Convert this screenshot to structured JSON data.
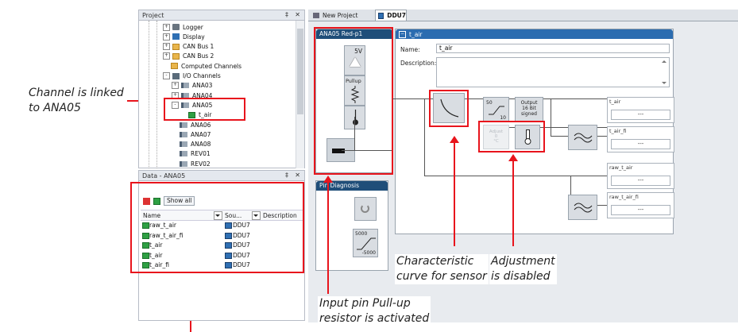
{
  "annotations": {
    "channel_linked": [
      "Channel is linked",
      "to ANA05"
    ],
    "characteristic": [
      "Characteristic",
      "curve for sensor"
    ],
    "adjustment": [
      "Adjustment",
      "is disabled"
    ],
    "pullup": [
      "Input pin Pull-up",
      "resistor is activated"
    ]
  },
  "project_panel": {
    "title": "Project",
    "pin_glyph": "‡",
    "close_glyph": "✕",
    "tree": [
      {
        "label": "Logger",
        "icon": "logger-icon",
        "indent": 0,
        "expander": "+"
      },
      {
        "label": "Display",
        "icon": "display-icon",
        "indent": 0,
        "expander": "+"
      },
      {
        "label": "CAN Bus 1",
        "icon": "folder-icon",
        "indent": 0,
        "expander": "+"
      },
      {
        "label": "CAN Bus 2",
        "icon": "folder-icon",
        "indent": 0,
        "expander": "+"
      },
      {
        "label": "Computed Channels",
        "icon": "folder-icon",
        "indent": 0,
        "expander": ""
      },
      {
        "label": "I/O Channels",
        "icon": "io-icon",
        "indent": 0,
        "expander": "-"
      },
      {
        "label": "ANA03",
        "icon": "pin-icon",
        "indent": 1,
        "expander": "+"
      },
      {
        "label": "ANA04",
        "icon": "pin-icon",
        "indent": 1,
        "expander": "+"
      },
      {
        "label": "ANA05",
        "icon": "pin-icon",
        "indent": 1,
        "expander": "-"
      },
      {
        "label": "t_air",
        "icon": "channel-icon",
        "indent": 2,
        "expander": ""
      },
      {
        "label": "ANA06",
        "icon": "pin-icon",
        "indent": 1,
        "expander": ""
      },
      {
        "label": "ANA07",
        "icon": "pin-icon",
        "indent": 1,
        "expander": ""
      },
      {
        "label": "ANA08",
        "icon": "pin-icon",
        "indent": 1,
        "expander": ""
      },
      {
        "label": "REV01",
        "icon": "pin-icon",
        "indent": 1,
        "expander": ""
      },
      {
        "label": "REV02",
        "icon": "pin-icon",
        "indent": 1,
        "expander": ""
      }
    ]
  },
  "data_panel": {
    "title": "Data - ANA05",
    "show_all": "Show all",
    "columns": [
      "Name",
      "Sou...",
      "Description"
    ],
    "rows": [
      {
        "name": "raw_t_air",
        "source": "DDU7"
      },
      {
        "name": "raw_t_air_fi",
        "source": "DDU7"
      },
      {
        "name": "t_air",
        "source": "DDU7"
      },
      {
        "name": "t_air",
        "source": "DDU7"
      },
      {
        "name": "t_air_fi",
        "source": "DDU7"
      }
    ]
  },
  "tabs": [
    {
      "label": "New Project",
      "active": false
    },
    {
      "label": "DDU7",
      "active": true
    }
  ],
  "pin_block": {
    "title": "ANA05 Red-p1",
    "voltage": "5V",
    "pullup": "Pullup"
  },
  "pin_diagnosis": {
    "title": "Pin Diagnosis",
    "hi": "5000",
    "lo": "-5000"
  },
  "channel": {
    "title": "t_air",
    "name_label": "Name:",
    "name_value": "t_air",
    "description_label": "Description:",
    "description_value": ""
  },
  "blocks": {
    "scale_top": "50",
    "scale_bottom": "10",
    "output": [
      "Output",
      "16 Bit",
      "signed"
    ],
    "adjust": [
      "Adjust",
      "0",
      "°C"
    ]
  },
  "outputs": [
    {
      "label": "t_air",
      "value": "---"
    },
    {
      "label": "t_air_fi",
      "value": "---"
    },
    {
      "label": "raw_t_air",
      "value": "---"
    },
    {
      "label": "raw_t_air_fi",
      "value": "---"
    }
  ],
  "colors": {
    "accent_red": "#e8141c",
    "panel_header_blue": "#1f4e79",
    "channel_header_blue": "#2b6cb0"
  }
}
